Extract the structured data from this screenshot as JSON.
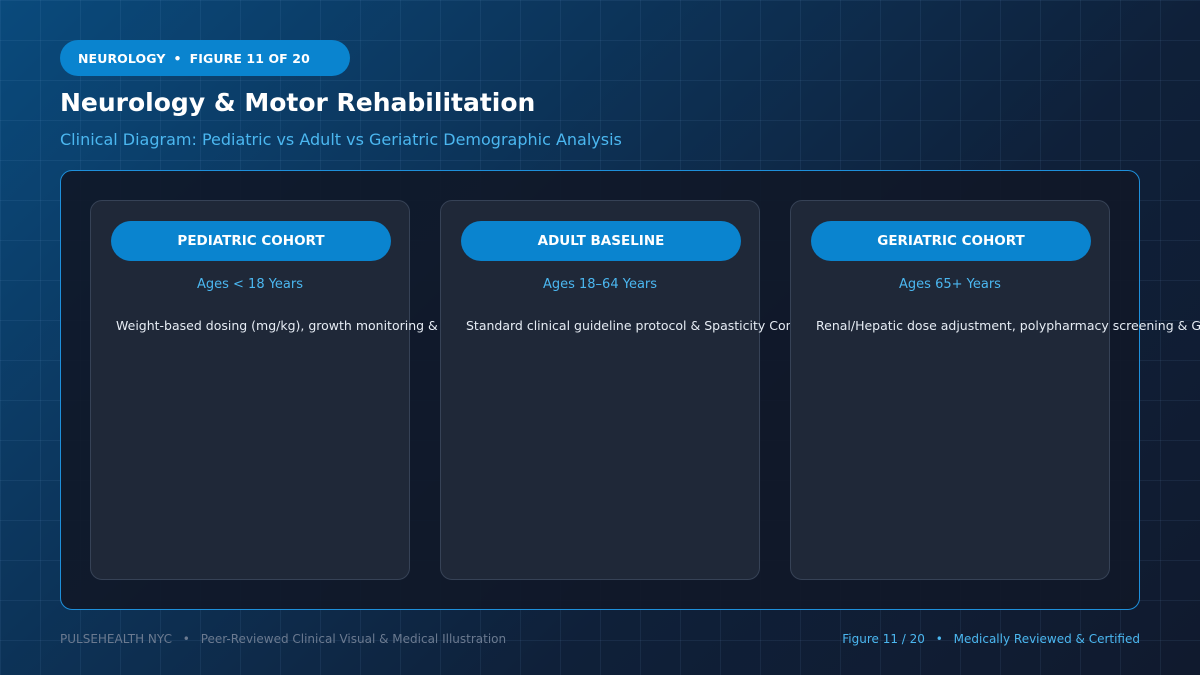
{
  "header": {
    "category": "NEUROLOGY",
    "figure_label": "FIGURE 11 OF 20",
    "separator": "•",
    "title": "Neurology & Motor Rehabilitation",
    "subtitle": "Clinical Diagram: Pediatric vs Adult vs Geriatric Demographic Analysis"
  },
  "cohorts": [
    {
      "label": "PEDIATRIC COHORT",
      "ages": "Ages < 18 Years",
      "description": "Weight-based dosing (mg/kg), growth monitoring & Up"
    },
    {
      "label": "ADULT BASELINE",
      "ages": "Ages 18–64 Years",
      "description": "Standard clinical guideline protocol & Spasticity Control"
    },
    {
      "label": "GERIATRIC COHORT",
      "ages": "Ages 65+ Years",
      "description": "Renal/Hepatic dose adjustment, polypharmacy screening & GMFC"
    }
  ],
  "footer": {
    "brand": "PULSEHEALTH NYC",
    "tagline": "Peer-Reviewed Clinical Visual & Medical Illustration",
    "figure": "Figure 11 / 20",
    "certification": "Medically Reviewed & Certified",
    "separator": "•"
  },
  "colors": {
    "accent": "#0a84cf",
    "highlight": "#4bb7f0",
    "card": "#1f2838",
    "frame_border": "#1e8fda"
  }
}
